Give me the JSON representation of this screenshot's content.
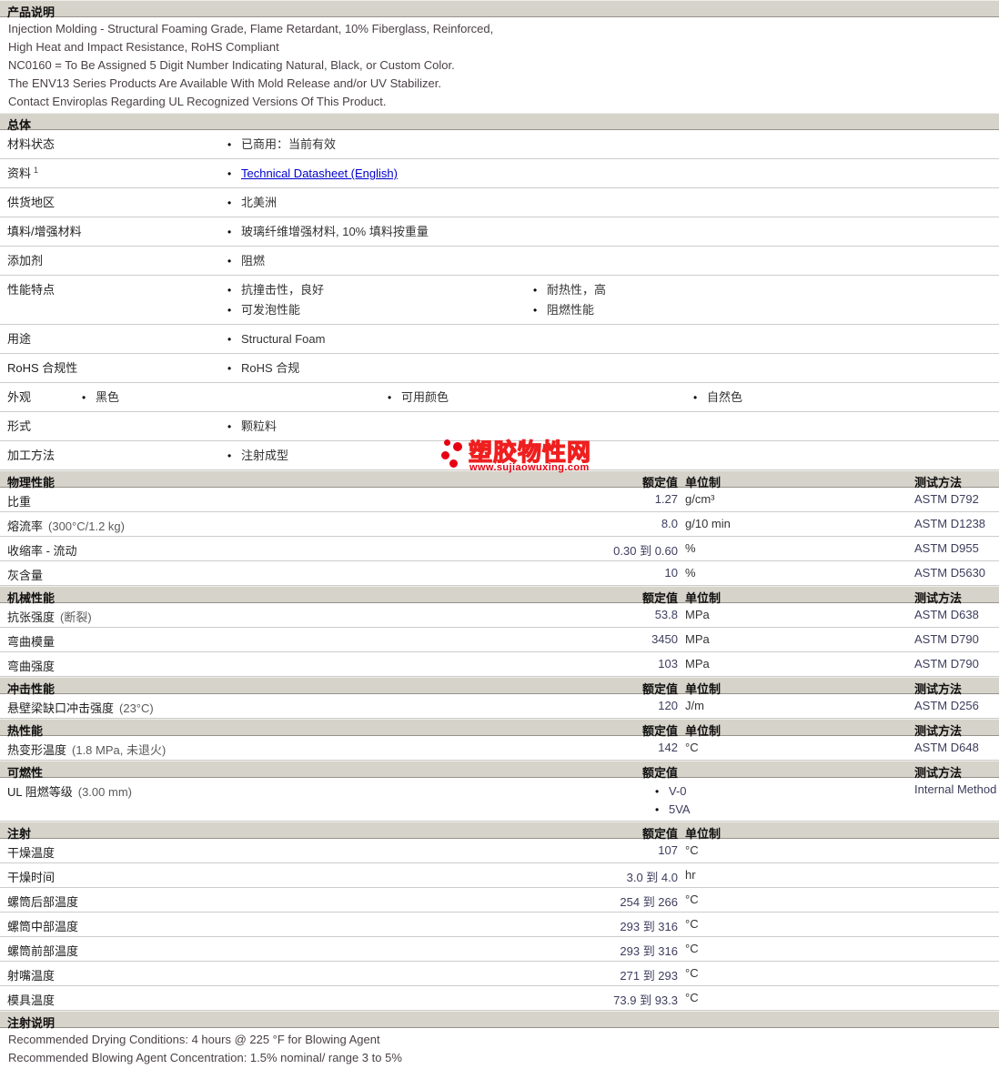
{
  "colors": {
    "section_bar_bg": "#d6d3ca",
    "row_divider": "#cccccc",
    "link_blue": "#0000cc",
    "value_navy": "#3d3d5e",
    "note_maroon": "#4a4046",
    "watermark_red": "#e60012"
  },
  "product_notes": {
    "title": "产品说明",
    "lines": [
      "Injection Molding - Structural Foaming Grade, Flame Retardant, 10% Fiberglass, Reinforced,",
      "High Heat and Impact Resistance, RoHS Compliant",
      "NC0160 = To Be Assigned 5 Digit Number Indicating Natural, Black, or Custom Color.",
      "The ENV13 Series Products Are Available With Mold Release and/or UV Stabilizer.",
      "Contact Enviroplas Regarding UL Recognized Versions Of This Product."
    ]
  },
  "general": {
    "title": "总体",
    "rows": [
      {
        "label": "材料状态",
        "columns": [
          [
            "已商用：当前有效"
          ]
        ]
      },
      {
        "label": "资料",
        "label_sup": "1",
        "link": true,
        "columns": [
          [
            "Technical Datasheet (English)"
          ]
        ]
      },
      {
        "label": "供货地区",
        "columns": [
          [
            "北美洲"
          ]
        ]
      },
      {
        "label": "填料/增强材料",
        "columns": [
          [
            "玻璃纤维增强材料, 10% 填料按重量"
          ]
        ]
      },
      {
        "label": "添加剂",
        "columns": [
          [
            "阻燃"
          ]
        ]
      },
      {
        "label": "性能特点",
        "columns": [
          [
            "抗撞击性，良好",
            "可发泡性能"
          ],
          [
            "耐热性，高",
            "阻燃性能"
          ]
        ]
      },
      {
        "label": "用途",
        "columns": [
          [
            "Structural Foam"
          ]
        ]
      },
      {
        "label": "RoHS 合规性",
        "columns": [
          [
            "RoHS 合规"
          ]
        ]
      },
      {
        "label": "外观",
        "columns": [
          [
            "黑色"
          ],
          [
            "可用颜色"
          ],
          [
            "自然色"
          ]
        ]
      },
      {
        "label": "形式",
        "columns": [
          [
            "颗粒料"
          ]
        ]
      },
      {
        "label": "加工方法",
        "columns": [
          [
            "注射成型"
          ]
        ]
      }
    ]
  },
  "property_tables": [
    {
      "id": "physical",
      "title": "物理性能",
      "rating_header": "额定值",
      "unit_header": "单位制",
      "method_header": "测试方法",
      "rows": [
        {
          "label": "比重",
          "rating": "1.27",
          "unit": "g/cm³",
          "method": "ASTM D792"
        },
        {
          "label": "熔流率",
          "condition": "(300°C/1.2 kg)",
          "rating": "8.0",
          "unit": "g/10 min",
          "method": "ASTM D1238"
        },
        {
          "label": "收缩率 - 流动",
          "rating": "0.30 到 0.60",
          "unit": "%",
          "method": "ASTM D955"
        },
        {
          "label": "灰含量",
          "rating": "10",
          "unit": "%",
          "method": "ASTM D5630"
        }
      ]
    },
    {
      "id": "mechanical",
      "title": "机械性能",
      "rating_header": "额定值",
      "unit_header": "单位制",
      "method_header": "测试方法",
      "rows": [
        {
          "label": "抗张强度",
          "condition": "(断裂)",
          "rating": "53.8",
          "unit": "MPa",
          "method": "ASTM D638"
        },
        {
          "label": "弯曲模量",
          "rating": "3450",
          "unit": "MPa",
          "method": "ASTM D790"
        },
        {
          "label": "弯曲强度",
          "rating": "103",
          "unit": "MPa",
          "method": "ASTM D790"
        }
      ]
    },
    {
      "id": "impact",
      "title": "冲击性能",
      "rating_header": "额定值",
      "unit_header": "单位制",
      "method_header": "测试方法",
      "rows": [
        {
          "label": "悬壁梁缺口冲击强度",
          "condition": "(23°C)",
          "rating": "120",
          "unit": "J/m",
          "method": "ASTM D256"
        }
      ]
    },
    {
      "id": "thermal",
      "title": "热性能",
      "rating_header": "额定值",
      "unit_header": "单位制",
      "method_header": "测试方法",
      "rows": [
        {
          "label": "热变形温度",
          "condition": "(1.8 MPa, 未退火)",
          "rating": "142",
          "unit": "°C",
          "method": "ASTM D648"
        }
      ]
    },
    {
      "id": "flammability",
      "title": "可燃性",
      "rating_header": "额定值",
      "unit_header": "",
      "method_header": "测试方法",
      "rows": [
        {
          "label": "UL 阻燃等级",
          "condition": "(3.00 mm)",
          "bullets": [
            "V-0",
            "5VA"
          ],
          "method": "Internal Method"
        }
      ]
    },
    {
      "id": "injection",
      "title": "注射",
      "rating_header": "额定值",
      "unit_header": "单位制",
      "method_header": "",
      "rows": [
        {
          "label": "干燥温度",
          "rating": "107",
          "unit": "°C"
        },
        {
          "label": "干燥时间",
          "rating": "3.0 到 4.0",
          "unit": "hr"
        },
        {
          "label": "螺筒后部温度",
          "rating": "254 到 266",
          "unit": "°C"
        },
        {
          "label": "螺筒中部温度",
          "rating": "293 到 316",
          "unit": "°C"
        },
        {
          "label": "螺筒前部温度",
          "rating": "293 到 316",
          "unit": "°C"
        },
        {
          "label": "射嘴温度",
          "rating": "271 到 293",
          "unit": "°C"
        },
        {
          "label": "模具温度",
          "rating": "73.9 到 93.3",
          "unit": "°C"
        }
      ]
    }
  ],
  "injection_notes": {
    "title": "注射说明",
    "lines": [
      "Recommended Drying Conditions: 4 hours @ 225 °F for Blowing Agent",
      "Recommended Blowing Agent Concentration: 1.5% nominal/ range 3 to 5%"
    ]
  },
  "watermark": {
    "name": "塑胶物性网",
    "url": "www.sujiaowuxing.com"
  }
}
